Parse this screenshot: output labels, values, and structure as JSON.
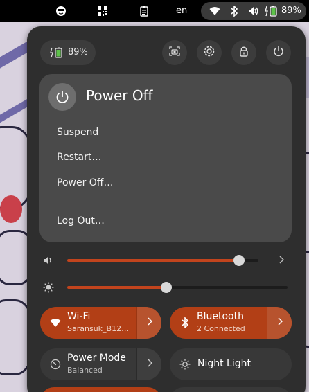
{
  "topbar": {
    "icons": [
      "face-sunglasses-icon",
      "qr-code-icon",
      "clipboard-icon"
    ],
    "language": "en",
    "status_icons": [
      "wifi-icon",
      "bluetooth-icon",
      "volume-icon",
      "battery-charging-icon"
    ],
    "battery_percent": "89%"
  },
  "panel": {
    "battery": {
      "icon": "battery-charging-icon",
      "label": "89%"
    },
    "header_buttons": [
      "screenshot-icon",
      "settings-icon",
      "lock-icon",
      "power-icon"
    ],
    "power_menu": {
      "title": "Power Off",
      "items": [
        "Suspend",
        "Restart…",
        "Power Off…"
      ],
      "footer_item": "Log Out…"
    },
    "volume": {
      "icon": "volume-icon",
      "level": 0.9
    },
    "brightness": {
      "icon": "brightness-icon",
      "level": 0.45
    },
    "tiles": [
      {
        "icon": "wifi-icon",
        "title": "Wi-Fi",
        "subtitle": "Saransuk_B12…",
        "active": true
      },
      {
        "icon": "bluetooth-icon",
        "title": "Bluetooth",
        "subtitle": "2 Connected",
        "active": true
      },
      {
        "icon": "power-mode-icon",
        "title": "Power Mode",
        "subtitle": "Balanced",
        "active": false
      },
      {
        "icon": "night-light-icon",
        "title": "Night Light",
        "active": false
      }
    ]
  },
  "colors": {
    "accent": "#b23f16",
    "panel_bg": "#2e2e2e",
    "menu_bg": "#4a4a4a"
  }
}
